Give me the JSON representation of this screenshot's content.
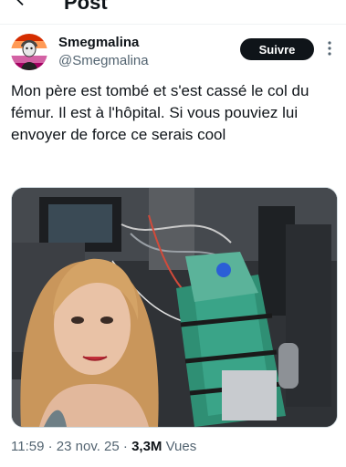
{
  "header": {
    "title": "Post"
  },
  "author": {
    "display_name": "Smegmalina",
    "handle": "@Smegmalina"
  },
  "actions": {
    "follow_label": "Suivre"
  },
  "tweet": {
    "text": "Mon père est tombé et s'est cassé le col du fémur. Il est à l'hôpital. Si vous pouviez lui envoyer de force ce serais cool"
  },
  "meta": {
    "time": "11:59",
    "separator1": " · ",
    "date": "23 nov. 25",
    "separator2": " · ",
    "views_count": "3,3M",
    "views_label": " Vues"
  },
  "icons": {
    "back": "arrow-left-icon",
    "more": "more-options-icon",
    "avatar": "avatar-image"
  },
  "colors": {
    "follow_button_bg": "#0f1419",
    "secondary_text": "#536471",
    "divider": "#eff3f4"
  }
}
